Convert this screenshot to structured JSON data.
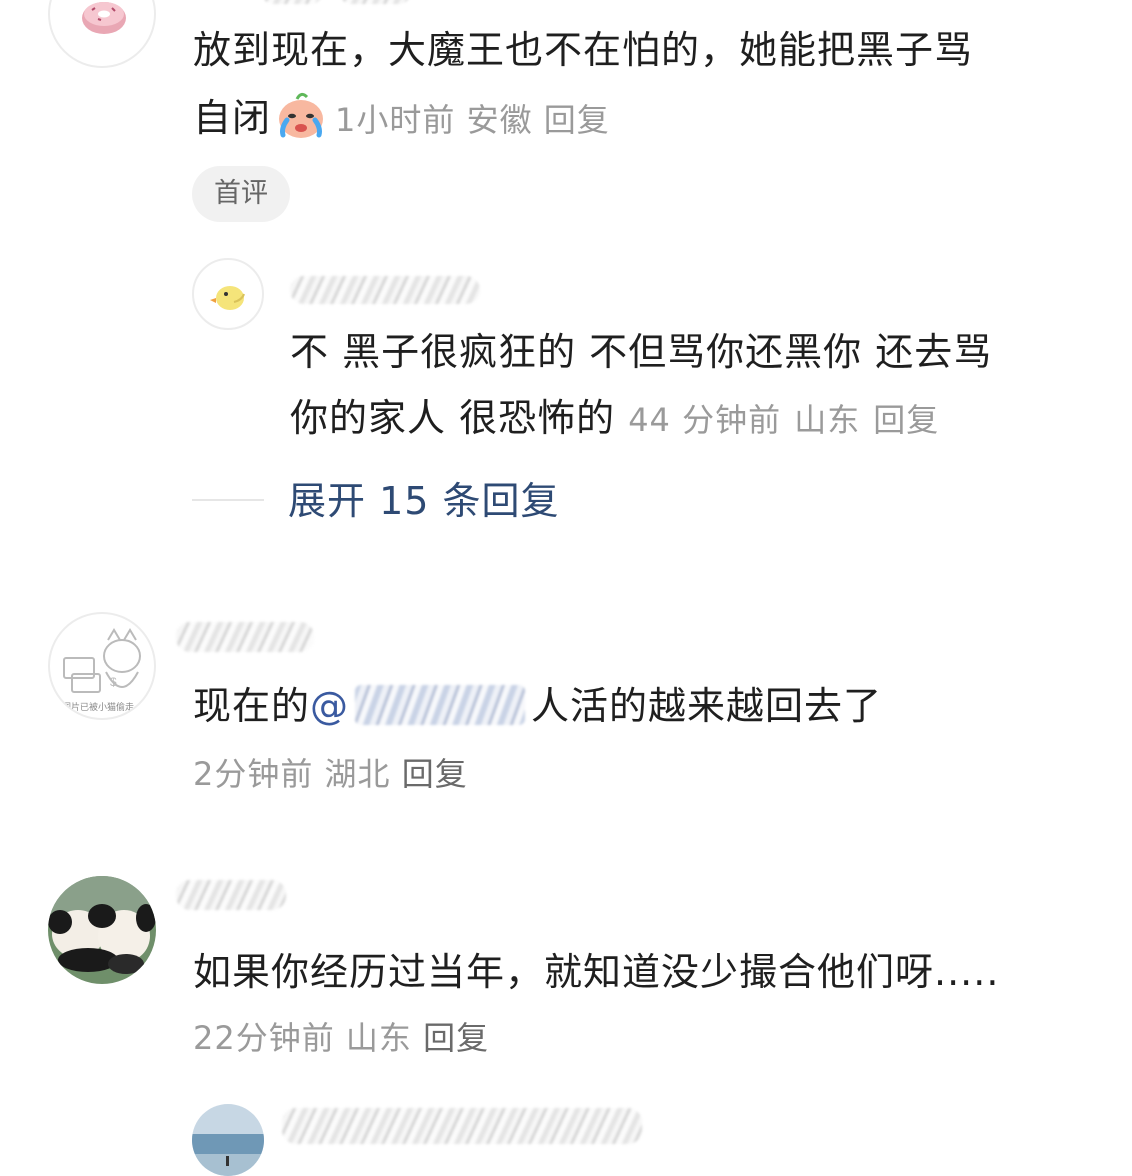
{
  "comments": [
    {
      "text_line1": "放到现在，大魔王也不在怕的，她能把黑子骂",
      "text_line2": "自闭",
      "emoji": "crying-face-icon",
      "time": "1小时前",
      "location": "安徽",
      "reply": "回复",
      "badge": "首评",
      "avatar_icon": "donut-icon",
      "sub_reply": {
        "avatar_icon": "duck-icon",
        "text_line1": "不 黑子很疯狂的 不但骂你还黑你 还去骂",
        "text_line2": "你的家人 很恐怖的",
        "time": "44 分钟前",
        "location": "山东",
        "reply": "回复"
      },
      "expand_label": "展开 15 条回复"
    },
    {
      "avatar_icon": "cartoon-cat-avatar",
      "avatar_caption": "图片已被小猫偷走",
      "text_before": "现在的",
      "mention_at": "@",
      "text_after": "人活的越来越回去了",
      "time": "2分钟前",
      "location": "湖北",
      "reply": "回复"
    },
    {
      "avatar_icon": "panda-photo-avatar",
      "text": "如果你经历过当年，就知道没少撮合他们呀.....",
      "time": "22分钟前",
      "location": "山东",
      "reply": "回复"
    }
  ],
  "colors": {
    "text": "#1f1f1f",
    "meta": "#9a9a9a",
    "link": "#2e4a74",
    "badge_bg": "#f1f1f1"
  }
}
